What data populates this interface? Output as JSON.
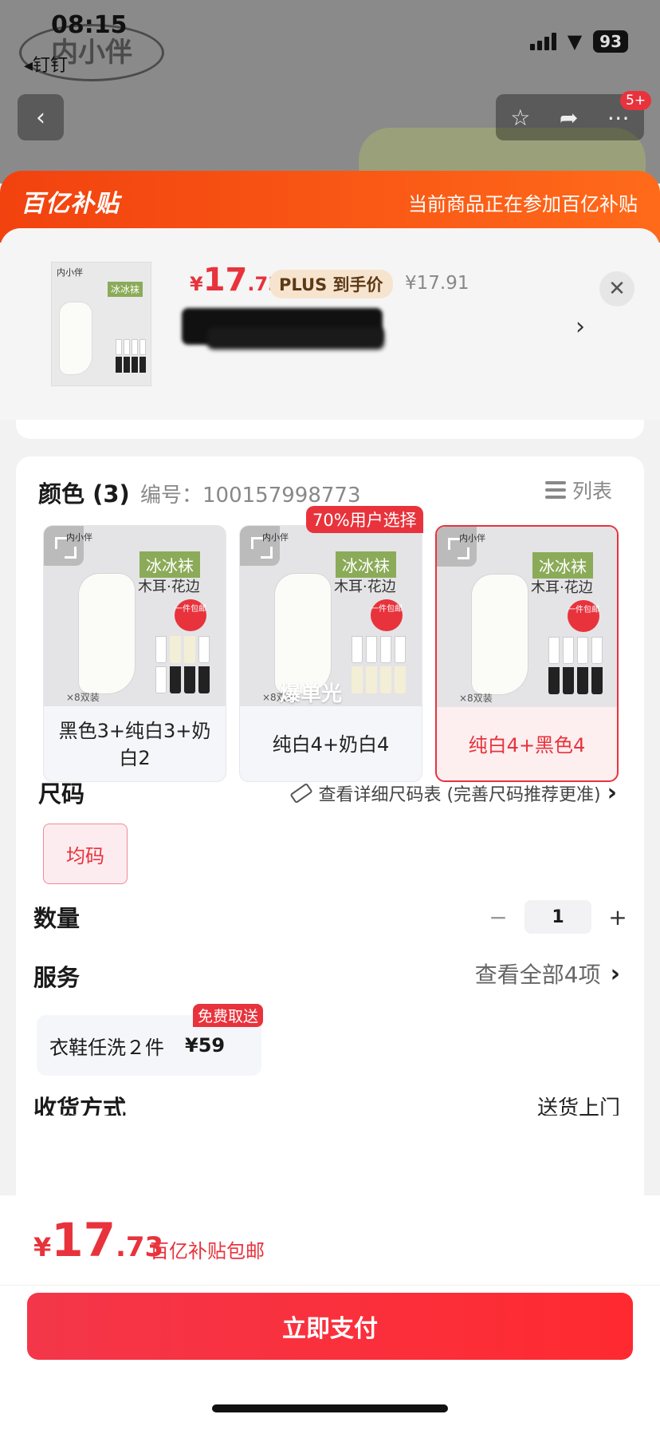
{
  "status_bar": {
    "time": "08:15",
    "back_app": "◂钉钉",
    "battery": "93"
  },
  "background": {
    "brand_text": "内小伴",
    "nav_badge": "5+"
  },
  "banner": {
    "logo": "百亿补贴",
    "text": "当前商品正在参加百亿补贴"
  },
  "product": {
    "price_currency": "¥",
    "price_int": "17",
    "price_dec": ".73",
    "plus_label": "PLUS 到手价",
    "original_price": "¥17.91",
    "thumb_brand": "内小伴",
    "thumb_tag": "冰冰袜"
  },
  "color_section": {
    "title": "颜色 (3)",
    "sku_number": "编号：100157998773",
    "list_label": "列表",
    "popular_badge": "70%用户选择",
    "variants": [
      {
        "label": "黑色3+纯白3+奶白2",
        "brand": "内小伴",
        "tag": "冰冰袜",
        "sub": "木耳·花边",
        "caption": "×8双装",
        "selected": false
      },
      {
        "label": "纯白4+奶白4",
        "brand": "内小伴",
        "tag": "冰冰袜",
        "sub": "木耳·花边",
        "caption": "×8双装",
        "overlay": "爆单光",
        "selected": false
      },
      {
        "label": "纯白4+黑色4",
        "brand": "内小伴",
        "tag": "冰冰袜",
        "sub": "木耳·花边",
        "caption": "×8双装",
        "selected": true
      }
    ],
    "badge_text": "一件包邮"
  },
  "size_section": {
    "title": "尺码",
    "guide": "查看详细尺码表 (完善尺码推荐更准)",
    "option": "均码"
  },
  "quantity": {
    "title": "数量",
    "minus": "−",
    "value": "1",
    "plus": "+"
  },
  "services": {
    "title": "服务",
    "link": "查看全部4项",
    "item_name": "衣鞋任洗２件",
    "item_price": "¥59",
    "item_badge": "免费取送"
  },
  "delivery": {
    "title": "收货方式",
    "value": "送货上门"
  },
  "footer": {
    "price_currency": "¥",
    "price_int": "17",
    "price_dec": ".73",
    "note": "百亿补贴包邮",
    "pay_label": "立即支付"
  },
  "colors": {
    "accent": "#e8333c",
    "banner": "#f2420f",
    "tag_green": "#8bab59"
  }
}
